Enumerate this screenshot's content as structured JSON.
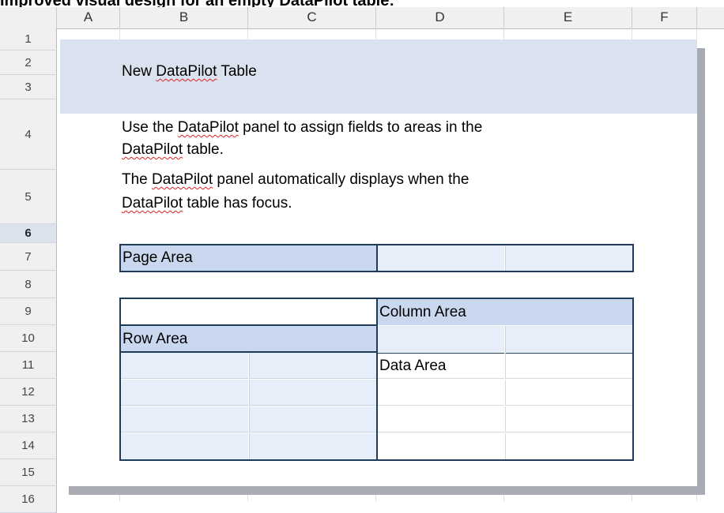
{
  "caption": "Improved visual design for an empty DataPilot table:",
  "columns": [
    "A",
    "B",
    "C",
    "D",
    "E",
    "F"
  ],
  "rows": [
    "1",
    "2",
    "3",
    "4",
    "5",
    "6",
    "7",
    "8",
    "9",
    "10",
    "11",
    "12",
    "13",
    "14",
    "15",
    "16"
  ],
  "selected_row": "6",
  "title": {
    "pre": "New ",
    "word": "DataPilot",
    "post": " Table"
  },
  "instructions": {
    "line1_pre": "Use the ",
    "line1_word": "DataPilot",
    "line1_post": " panel to assign fields to areas in the",
    "line2_word": "DataPilot",
    "line2_post": " table.",
    "line3_pre": "The ",
    "line3_word": "DataPilot",
    "line3_post": " panel automatically displays when the",
    "line4_word": "DataPilot",
    "line4_post": " table has focus."
  },
  "areas": {
    "page": "Page Area",
    "column": "Column Area",
    "row": "Row Area",
    "data": "Data Area"
  }
}
